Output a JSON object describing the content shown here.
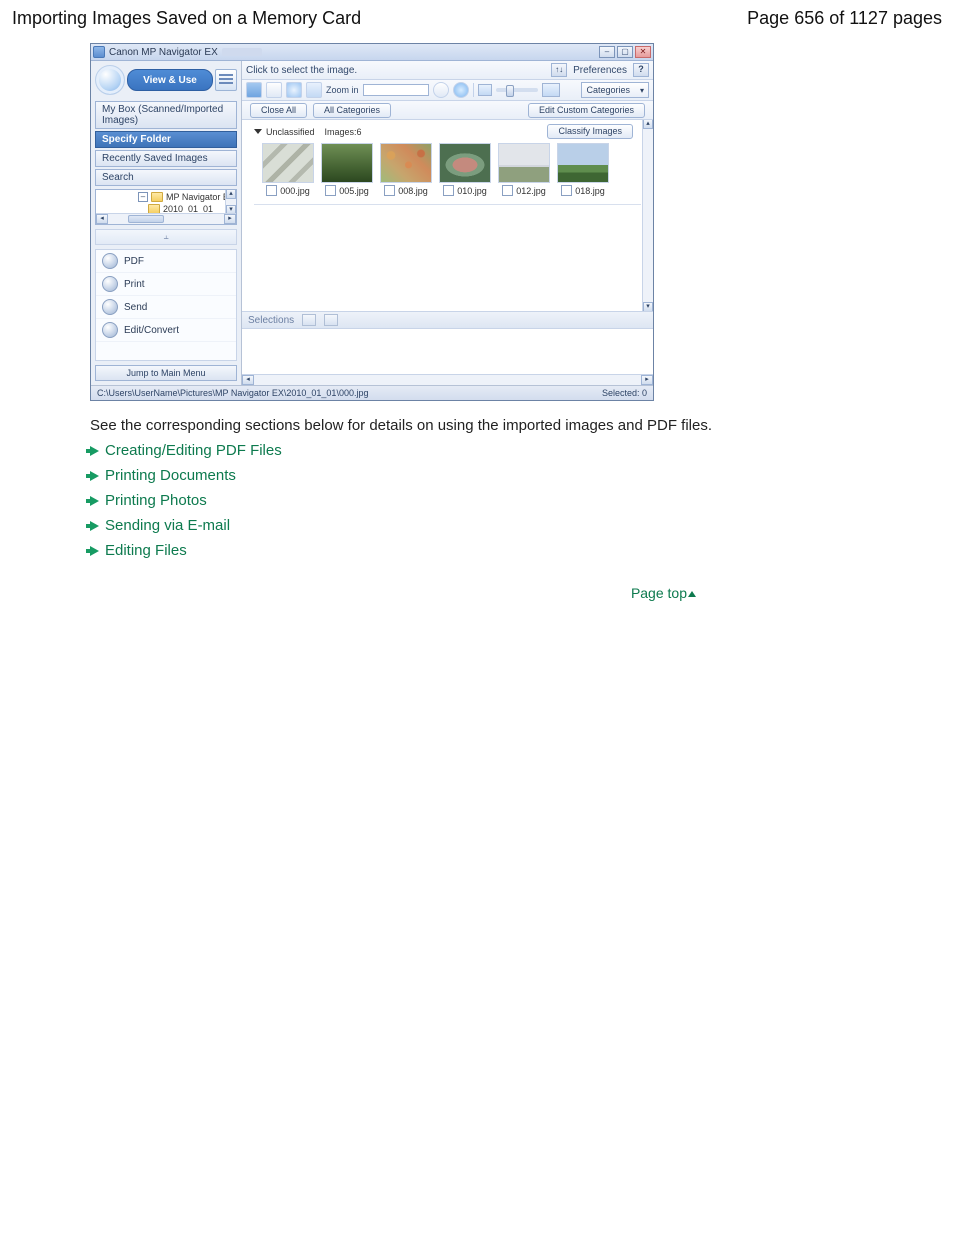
{
  "page": {
    "title": "Importing Images Saved on a Memory Card",
    "counter": "Page 656 of 1127 pages"
  },
  "app": {
    "title": "Canon MP Navigator EX",
    "instruction": "Click to select the image.",
    "preferences_label": "Preferences",
    "sort_glyph": "↑↓",
    "help_glyph": "?",
    "viewuse_label": "View & Use",
    "left_tabs": {
      "mybox": "My Box (Scanned/Imported Images)",
      "specify": "Specify Folder",
      "recent": "Recently Saved Images",
      "search": "Search"
    },
    "tree": {
      "root": "MP Navigator EX",
      "child": "2010_01_01"
    },
    "pin_glyph": "⫠",
    "actions": {
      "pdf": "PDF",
      "print": "Print",
      "send": "Send",
      "edit": "Edit/Convert"
    },
    "jump_label": "Jump to Main Menu",
    "toolbar": {
      "zoomin": "Zoom in",
      "categories_label": "Categories",
      "close_all": "Close All",
      "all_categories": "All Categories",
      "edit_custom": "Edit Custom Categories",
      "classify": "Classify Images"
    },
    "group": {
      "name": "Unclassified",
      "count_label": "Images:6"
    },
    "thumbs": [
      {
        "label": "000.jpg"
      },
      {
        "label": "005.jpg"
      },
      {
        "label": "008.jpg"
      },
      {
        "label": "010.jpg"
      },
      {
        "label": "012.jpg"
      },
      {
        "label": "018.jpg"
      }
    ],
    "selections_label": "Selections",
    "status": {
      "path": "C:\\Users\\UserName\\Pictures\\MP Navigator EX\\2010_01_01\\000.jpg",
      "selected": "Selected: 0"
    }
  },
  "body_text": "See the corresponding sections below for details on using the imported images and PDF files.",
  "links": {
    "l1": "Creating/Editing PDF Files",
    "l2": "Printing Documents",
    "l3": "Printing Photos",
    "l4": "Sending via E-mail",
    "l5": "Editing Files"
  },
  "pagetop": "Page top"
}
